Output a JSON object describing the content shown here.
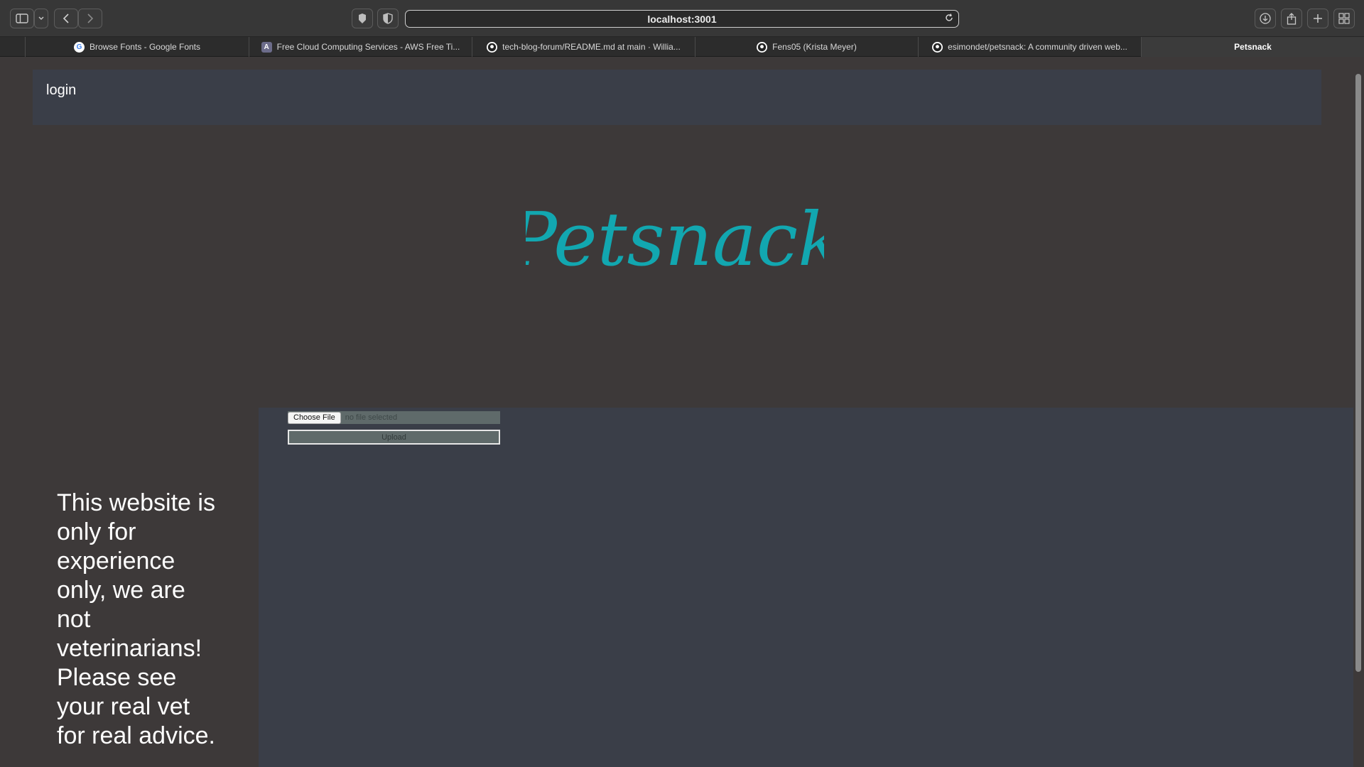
{
  "browser": {
    "url": "localhost:3001",
    "tabs": [
      {
        "label": "Browse Fonts - Google Fonts",
        "icon": "google-icon",
        "active": false
      },
      {
        "label": "Free Cloud Computing Services - AWS Free Ti...",
        "icon": "aws-icon",
        "active": false
      },
      {
        "label": "tech-blog-forum/README.md at main · Willia...",
        "icon": "github-icon",
        "active": false
      },
      {
        "label": "Fens05 (Krista Meyer)",
        "icon": "github-icon",
        "active": false
      },
      {
        "label": "esimondet/petsnack: A community driven web...",
        "icon": "github-icon",
        "active": false
      },
      {
        "label": "Petsnack",
        "icon": "",
        "active": true
      }
    ]
  },
  "header": {
    "login_label": "login"
  },
  "logo": {
    "text": "Petsnack",
    "color": "#12a7b0"
  },
  "upload": {
    "choose_label": "Choose File",
    "no_file_text": "no file selected",
    "upload_label": "Upload"
  },
  "disclaimer": "This website is only for experience only, we are not veterinarians! Please see your real vet for real advice."
}
